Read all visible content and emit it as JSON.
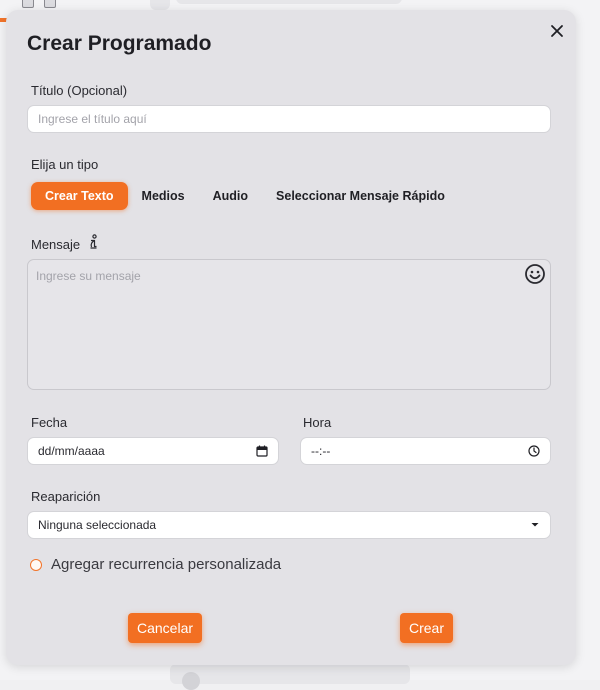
{
  "modal": {
    "title": "Crear Programado",
    "close_icon": "close-icon"
  },
  "title_field": {
    "label": "Título (Opcional)",
    "placeholder": "Ingrese el título aquí",
    "value": ""
  },
  "type_selector": {
    "label": "Elija un tipo",
    "tabs": [
      {
        "label": "Crear Texto",
        "active": true
      },
      {
        "label": "Medios",
        "active": false
      },
      {
        "label": "Audio",
        "active": false
      },
      {
        "label": "Seleccionar Mensaje Rápido",
        "active": false
      }
    ]
  },
  "message_field": {
    "label": "Mensaje",
    "info_icon": "info-icon",
    "placeholder": "Ingrese su mensaje",
    "value": "",
    "emoji_icon": "emoji-icon"
  },
  "date_field": {
    "label": "Fecha",
    "value": "dd/mm/aaaa",
    "icon": "calendar-icon"
  },
  "time_field": {
    "label": "Hora",
    "value": "--:--",
    "icon": "clock-icon"
  },
  "repeat_field": {
    "label": "Reaparición",
    "selected": "Ninguna seleccionada",
    "icon": "caret-down-icon"
  },
  "custom_recurrence": {
    "label": "Agregar recurrencia personalizada",
    "checked": false
  },
  "actions": {
    "cancel_label": "Cancelar",
    "create_label": "Crear"
  },
  "colors": {
    "accent": "#f26f22",
    "modal_bg": "#e3e2e6",
    "text": "#1f1f24"
  }
}
